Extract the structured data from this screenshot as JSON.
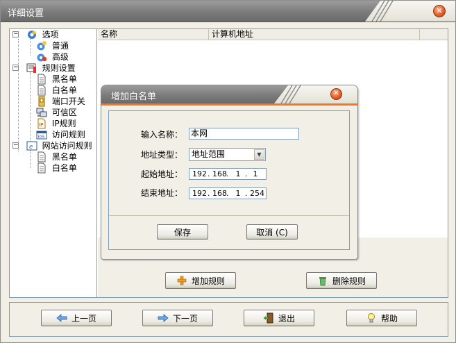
{
  "window": {
    "title": "详细设置"
  },
  "tree": {
    "items": [
      {
        "label": "选项",
        "icon": "options-gear-icon",
        "level": 0,
        "expander": "−"
      },
      {
        "label": "普通",
        "icon": "general-gear-icon",
        "level": 1
      },
      {
        "label": "高级",
        "icon": "advanced-gear-icon",
        "level": 1
      },
      {
        "label": "规则设置",
        "icon": "rules-settings-icon",
        "level": 0,
        "expander": "−"
      },
      {
        "label": "黑名单",
        "icon": "document-icon",
        "level": 1
      },
      {
        "label": "白名单",
        "icon": "document-icon",
        "level": 1
      },
      {
        "label": "端口开关",
        "icon": "port-switch-icon",
        "level": 1
      },
      {
        "label": "可信区",
        "icon": "trusted-zone-icon",
        "level": 1
      },
      {
        "label": "IP规则",
        "icon": "ip-rule-icon",
        "level": 1
      },
      {
        "label": "访问规则",
        "icon": "exe-access-icon",
        "level": 1
      },
      {
        "label": "网站访问规则",
        "icon": "website-rule-icon",
        "level": 0,
        "expander": "−"
      },
      {
        "label": "黑名单",
        "icon": "document-icon",
        "level": 1
      },
      {
        "label": "白名单",
        "icon": "document-icon",
        "level": 1
      }
    ]
  },
  "list": {
    "columns": [
      "名称",
      "计算机地址"
    ],
    "rows": []
  },
  "actions": {
    "add_rule": "增加规则",
    "delete_rule": "删除规则"
  },
  "nav": {
    "prev": "上一页",
    "next": "下一页",
    "exit": "退出",
    "help": "帮助"
  },
  "dialog": {
    "title": "增加白名单",
    "name_label": "输入名称：",
    "name_value": "本网",
    "type_label": "地址类型：",
    "type_value": "地址范围",
    "start_label": "起始地址：",
    "start_ip": [
      "192",
      "168",
      "1",
      "1"
    ],
    "end_label": "结束地址：",
    "end_ip": [
      "192",
      "168",
      "1",
      "254"
    ],
    "save": "保存",
    "cancel": "取消 (C)"
  },
  "colors": {
    "titlebar": "#7b7b7b",
    "accent_orange": "#f07820",
    "close_button": "#e25a25",
    "border_blue": "#7f9db9",
    "background": "#f1efe6"
  }
}
